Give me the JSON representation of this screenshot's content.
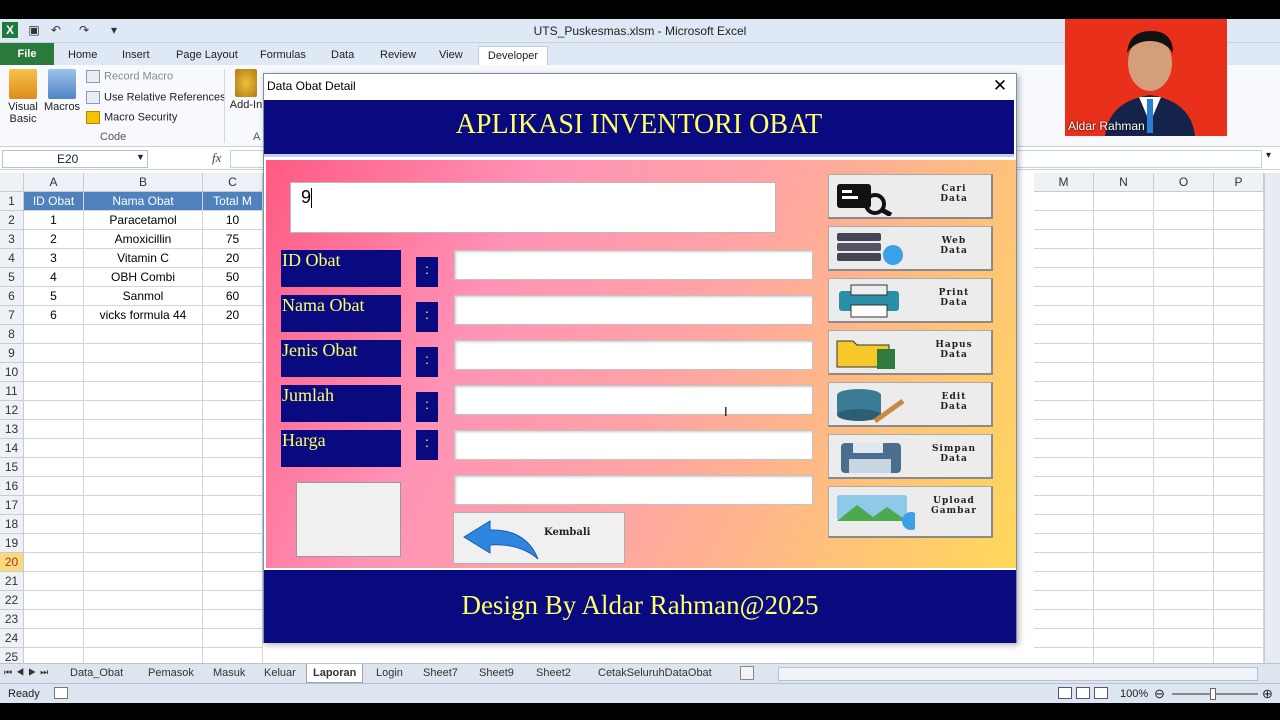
{
  "window": {
    "title": "UTS_Puskesmas.xlsm  -  Microsoft Excel"
  },
  "ribbon": {
    "tabs": [
      "File",
      "Home",
      "Insert",
      "Page Layout",
      "Formulas",
      "Data",
      "Review",
      "View",
      "Developer"
    ],
    "visual_basic": "Visual\nBasic",
    "macros": "Macros",
    "record_macro": "Record Macro",
    "relative_refs": "Use Relative References",
    "macro_security": "Macro Security",
    "code_group": "Code",
    "addins": "Add-In",
    "addins_group": "A"
  },
  "formula_bar": {
    "name_box": "E20",
    "fx": "fx"
  },
  "sheet": {
    "columns": [
      "A",
      "B",
      "C",
      "M",
      "N",
      "O",
      "P"
    ],
    "header": [
      "ID Obat",
      "Nama Obat",
      "Total M"
    ],
    "rows": [
      [
        "1",
        "Paracetamol",
        "10"
      ],
      [
        "2",
        "Amoxicillin",
        "75"
      ],
      [
        "3",
        "Vitamin C",
        "20"
      ],
      [
        "4",
        "OBH Combi",
        "50"
      ],
      [
        "5",
        "Sanmol",
        "60"
      ],
      [
        "6",
        "vicks formula 44",
        "20"
      ]
    ],
    "row_numbers": [
      "1",
      "2",
      "3",
      "4",
      "5",
      "6",
      "7",
      "8",
      "9",
      "10",
      "11",
      "12",
      "13",
      "14",
      "15",
      "16",
      "17",
      "18",
      "19",
      "20",
      "21",
      "22",
      "23",
      "24",
      "25"
    ]
  },
  "sheet_tabs": [
    "Data_Obat",
    "Pemasok",
    "Masuk",
    "Keluar",
    "Laporan",
    "Login",
    "Sheet7",
    "Sheet9",
    "Sheet2",
    "CetakSeluruhDataObat"
  ],
  "active_sheet": "Laporan",
  "status": {
    "ready": "Ready",
    "zoom": "100%"
  },
  "form": {
    "title": "Data Obat Detail",
    "close": "✕",
    "banner": "APLIKASI INVENTORI OBAT",
    "search_value": "9",
    "labels": [
      "ID Obat",
      "Nama Obat",
      "Jenis Obat",
      "Jumlah",
      "Harga"
    ],
    "colon": ":",
    "buttons": [
      "Cari\nData",
      "Web\nData",
      "Print\nData",
      "Hapus\nData",
      "Edit\nData",
      "Simpan\nData",
      "Upload\nGambar"
    ],
    "back": "Kembali",
    "footer": "Design By Aldar Rahman@2025"
  },
  "webcam": {
    "name": "Aldar Rahman"
  },
  "colors": {
    "navy": "#0a0a80",
    "yellow_text": "#ffff66",
    "excel_green": "#2a7a3b"
  }
}
